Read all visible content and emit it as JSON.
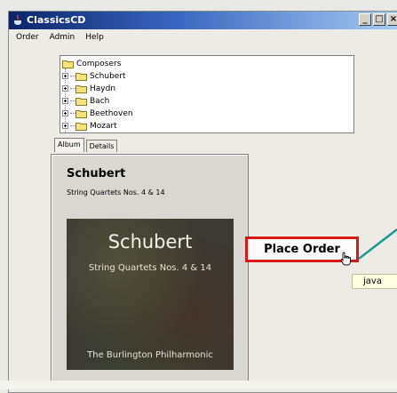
{
  "window": {
    "title": "ClassicsCD"
  },
  "menu": {
    "items": [
      "Order",
      "Admin",
      "Help"
    ]
  },
  "tree": {
    "root": "Composers",
    "children": [
      "Schubert",
      "Haydn",
      "Bach",
      "Beethoven",
      "Mozart"
    ]
  },
  "tabs": {
    "album": "Album",
    "details": "Details"
  },
  "album": {
    "title": "Schubert",
    "subtitle": "String Quartets Nos. 4 & 14",
    "cover_title": "Schubert",
    "cover_subtitle": "String Quartets Nos. 4 & 14",
    "cover_performer": "The Burlington Philharmonic"
  },
  "actions": {
    "place_order": "Place Order"
  },
  "tooltip": {
    "text": "java"
  },
  "colors": {
    "highlight_border": "#d71919",
    "connector": "#1a9a8c",
    "title_bar": "#0a246a"
  }
}
